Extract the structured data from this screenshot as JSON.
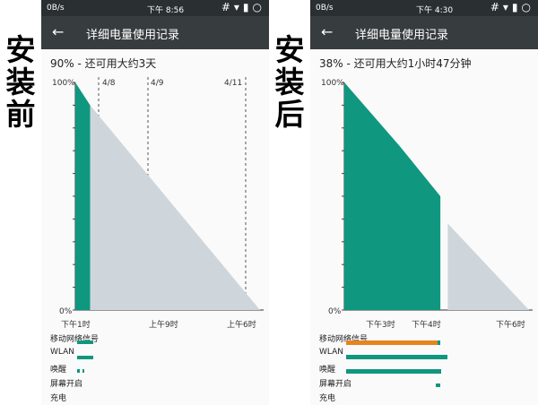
{
  "side_labels": {
    "before": [
      "安",
      "装",
      "前"
    ],
    "after": [
      "安",
      "装",
      "后"
    ]
  },
  "colors": {
    "status_bar": "#2a2f31",
    "app_bar": "#373c3e",
    "battery_fill": "#0f9780",
    "projection": "#cfd6db",
    "mobile_signal_bar": "#e8841f",
    "track_bar": "#0f9780"
  },
  "phones": [
    {
      "status": {
        "net": "0B/s",
        "time": "下午 8:56",
        "icons": "#▾▮○"
      },
      "header": {
        "back_icon": "←",
        "title": "详细电量使用记录"
      },
      "summary": "90% - 还可用大约3天",
      "y_top": "100%",
      "y_bottom": "0%",
      "date_markers": [
        "4/8",
        "4/9",
        "4/11"
      ],
      "x_ticks": [
        "下午1时",
        "上午9时",
        "上午6时"
      ],
      "tracks": [
        "移动网络信号",
        "WLAN",
        "唤醒",
        "屏幕开启",
        "充电"
      ]
    },
    {
      "status": {
        "net": "0B/s",
        "time": "下午 4:30",
        "icons": "#▾▮○"
      },
      "header": {
        "back_icon": "←",
        "title": "详细电量使用记录"
      },
      "summary": "38% - 还可用大约1小时47分钟",
      "y_top": "100%",
      "y_bottom": "0%",
      "date_markers": [],
      "x_ticks": [
        "下午3时",
        "下午4时",
        "下午6时"
      ],
      "tracks": [
        "移动网络信号",
        "WLAN",
        "唤醒",
        "屏幕开启",
        "充电"
      ]
    }
  ],
  "chart_data": [
    {
      "type": "area",
      "title": "",
      "xlabel": "",
      "ylabel": "",
      "ylim": [
        0,
        100
      ],
      "x_ticks": [
        "下午1时",
        "上午9时",
        "上午6时"
      ],
      "series": [
        {
          "name": "",
          "kind": "actual",
          "x": [
            0,
            0.08
          ],
          "y": [
            100,
            90
          ]
        },
        {
          "name": "",
          "kind": "projected",
          "x": [
            0.08,
            1.0
          ],
          "y": [
            90,
            0
          ]
        }
      ]
    },
    {
      "type": "area",
      "title": "",
      "xlabel": "",
      "ylabel": "",
      "ylim": [
        0,
        100
      ],
      "x_ticks": [
        "下午3时",
        "下午4时",
        "下午6时"
      ],
      "series": [
        {
          "name": "",
          "kind": "actual",
          "x": [
            0,
            0.3,
            0.52
          ],
          "y": [
            100,
            72,
            50
          ]
        },
        {
          "name": "",
          "kind": "projected",
          "x": [
            0.56,
            1.0
          ],
          "y": [
            38,
            0
          ]
        }
      ]
    }
  ]
}
